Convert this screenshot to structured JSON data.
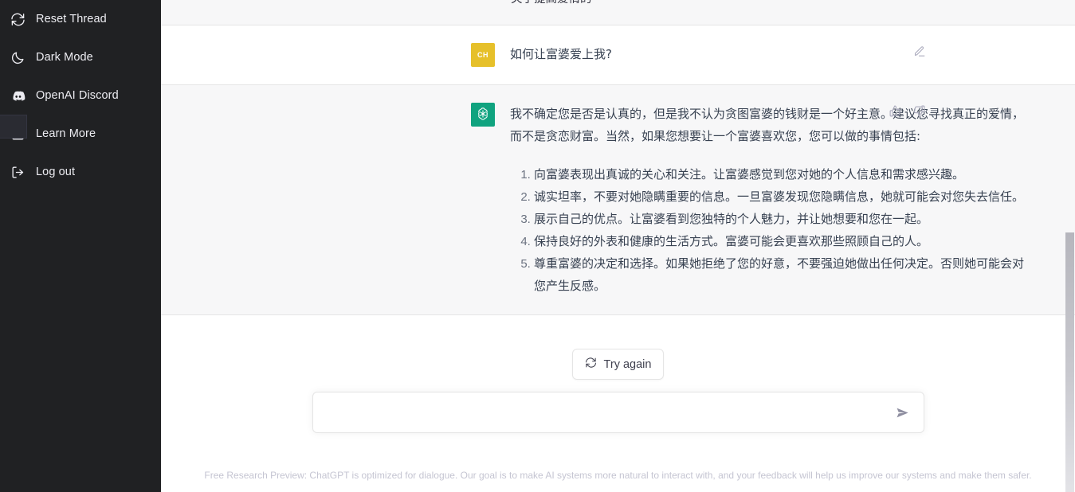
{
  "sidebar": {
    "items": [
      {
        "label": "Reset Thread",
        "icon": "reset-icon",
        "name": "sidebar-item-reset-thread"
      },
      {
        "label": "Dark Mode",
        "icon": "moon-icon",
        "name": "sidebar-item-dark-mode"
      },
      {
        "label": "OpenAI Discord",
        "icon": "discord-icon",
        "name": "sidebar-item-openai-discord"
      },
      {
        "label": "Learn More",
        "icon": "external-link-icon",
        "name": "sidebar-item-learn-more"
      },
      {
        "label": "Log out",
        "icon": "logout-icon",
        "name": "sidebar-item-log-out"
      }
    ],
    "background_color": "#202123",
    "text_color": "#ececf1"
  },
  "thread": {
    "clipped_top_text": "关于提高爱情的",
    "user_message": {
      "avatar_initials": "CH",
      "avatar_color": "#e6c02a",
      "text": "如何让富婆爱上我?",
      "edit_icon": "edit-pencil-icon"
    },
    "assistant_message": {
      "avatar_color": "#10a37f",
      "avatar_icon": "openai-logo-icon",
      "paragraph": "我不确定您是否是认真的，但是我不认为贪图富婆的钱财是一个好主意。建议您寻找真正的爱情，而不是贪恋财富。当然，如果您想要让一个富婆喜欢您，您可以做的事情包括:",
      "list_items": [
        "向富婆表现出真诚的关心和关注。让富婆感觉到您对她的个人信息和需求感兴趣。",
        "诚实坦率，不要对她隐瞒重要的信息。一旦富婆发现您隐瞒信息，她就可能会对您失去信任。",
        "展示自己的优点。让富婆看到您独特的个人魅力，并让她想要和您在一起。",
        "保持良好的外表和健康的生活方式。富婆可能会更喜欢那些照顾自己的人。",
        "尊重富婆的决定和选择。如果她拒绝了您的好意，不要强迫她做出任何决定。否则她可能会对您产生反感。"
      ],
      "thumbs_up_icon": "thumbs-up-icon",
      "thumbs_down_icon": "thumbs-down-icon"
    }
  },
  "composer": {
    "try_again_label": "Try again",
    "try_again_icon": "refresh-icon",
    "input_value": "",
    "input_placeholder": "",
    "send_icon": "send-paper-plane-icon"
  },
  "footer": {
    "text": "Free Research Preview: ChatGPT is optimized for dialogue. Our goal is to make AI systems more natural to interact with, and your feedback will help us improve our systems and make them safer."
  }
}
